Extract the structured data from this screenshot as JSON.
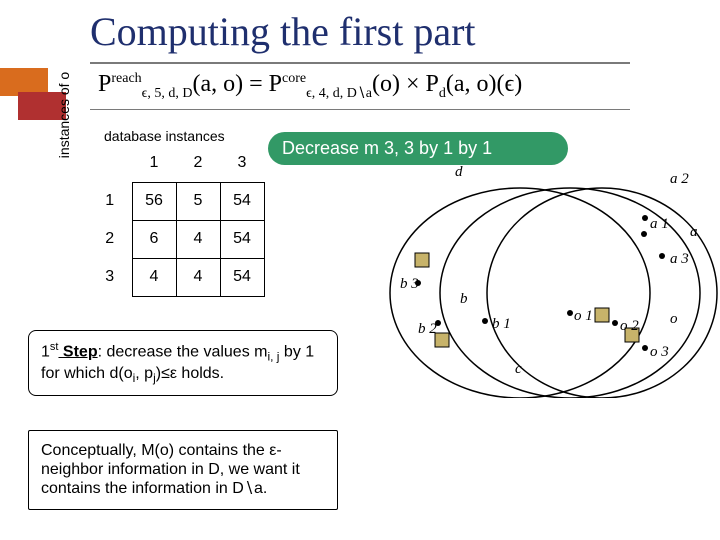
{
  "title": "Computing the first part",
  "formula_parts": {
    "lhs_P": "P",
    "lhs_sup": "reach",
    "lhs_sub": "ϵ, 5, d, D",
    "lhs_arg": "(a, o) = ",
    "mid_P": "P",
    "mid_sup": "core",
    "mid_sub": "ϵ, 4, d, D∖a",
    "mid_arg": "(o) × ",
    "rhs_P": "P",
    "rhs_sub": "d",
    "rhs_arg": "(a, o)(ϵ)"
  },
  "labels": {
    "db_instances": "database instances",
    "instances_of_o": "instances of o"
  },
  "table": {
    "cols": [
      "1",
      "2",
      "3"
    ],
    "rows": [
      "1",
      "2",
      "3"
    ],
    "cells": [
      [
        "56",
        "5",
        "54"
      ],
      [
        "6",
        "4",
        "54"
      ],
      [
        "4",
        "4",
        "54"
      ]
    ]
  },
  "decrease_bubble": "Decrease m 3, 3 by 1            by 1",
  "diagram_labels": {
    "d": "d",
    "a": "a",
    "a1": "a 1",
    "a2": "a 2",
    "a3": "a 3",
    "b": "b",
    "b1": "b 1",
    "b2": "b 2",
    "b3": "b 3",
    "c": "c",
    "o": "o",
    "o1": "o 1",
    "o2": "o 2",
    "o3": "o 3"
  },
  "step_box": {
    "prefix": "1",
    "sup": "st",
    "bold": " Step",
    "rest": ": decrease the values m",
    "sub": "i, j",
    "rest2": " by 1 for which  d(o",
    "sub2": "i",
    "rest3": ", p",
    "sub3": "j",
    "rest4": ")≤ε holds."
  },
  "concept_box": "Conceptually, M(o) contains the ε-neighbor information in D, we want it contains the information in D∖a."
}
